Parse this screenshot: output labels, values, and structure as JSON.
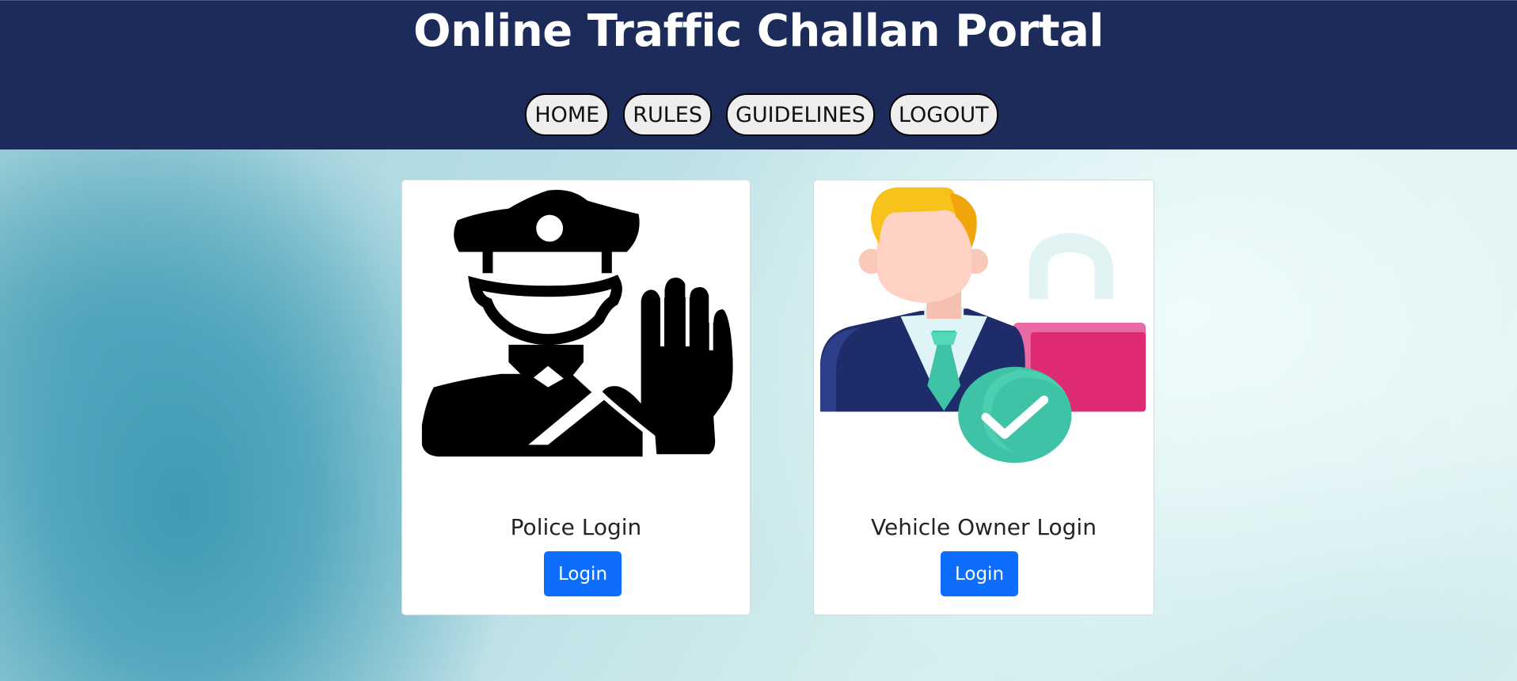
{
  "header": {
    "title": "Online Traffic Challan Portal",
    "background": "#1d2b5a"
  },
  "nav": {
    "items": [
      {
        "label": "HOME"
      },
      {
        "label": "RULES"
      },
      {
        "label": "GUIDELINES"
      },
      {
        "label": "LOGOUT"
      }
    ]
  },
  "cards": [
    {
      "title": "Police Login",
      "button_label": "Login",
      "icon": "police-officer-icon"
    },
    {
      "title": "Vehicle Owner Login",
      "button_label": "Login",
      "icon": "vehicle-owner-unlock-icon"
    }
  ],
  "colors": {
    "accent": "#0d6efd",
    "header": "#1d2b5a"
  }
}
